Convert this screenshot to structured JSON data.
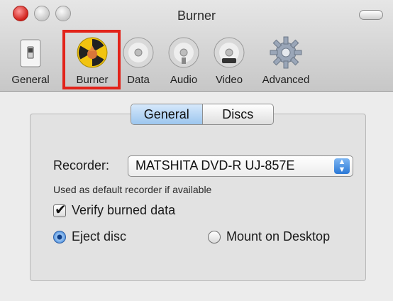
{
  "window": {
    "title": "Burner"
  },
  "toolbar": {
    "items": [
      {
        "label": "General",
        "icon": "switch-icon"
      },
      {
        "label": "Burner",
        "icon": "burner-radiation-icon"
      },
      {
        "label": "Data",
        "icon": "data-disc-icon"
      },
      {
        "label": "Audio",
        "icon": "audio-disc-icon"
      },
      {
        "label": "Video",
        "icon": "video-dvd-icon"
      },
      {
        "label": "Advanced",
        "icon": "gear-icon"
      }
    ],
    "selected": "Burner",
    "highlight_color": "#e2231a"
  },
  "tabs": [
    {
      "label": "General",
      "active": true
    },
    {
      "label": "Discs",
      "active": false
    }
  ],
  "form": {
    "recorder_label": "Recorder:",
    "recorder_value": "MATSHITA DVD-R UJ-857E",
    "hint": "Used as default recorder if available",
    "verify_label": "Verify burned data",
    "verify_checked": true,
    "eject_label": "Eject disc",
    "mount_label": "Mount on Desktop",
    "selected_option": "Eject disc"
  }
}
